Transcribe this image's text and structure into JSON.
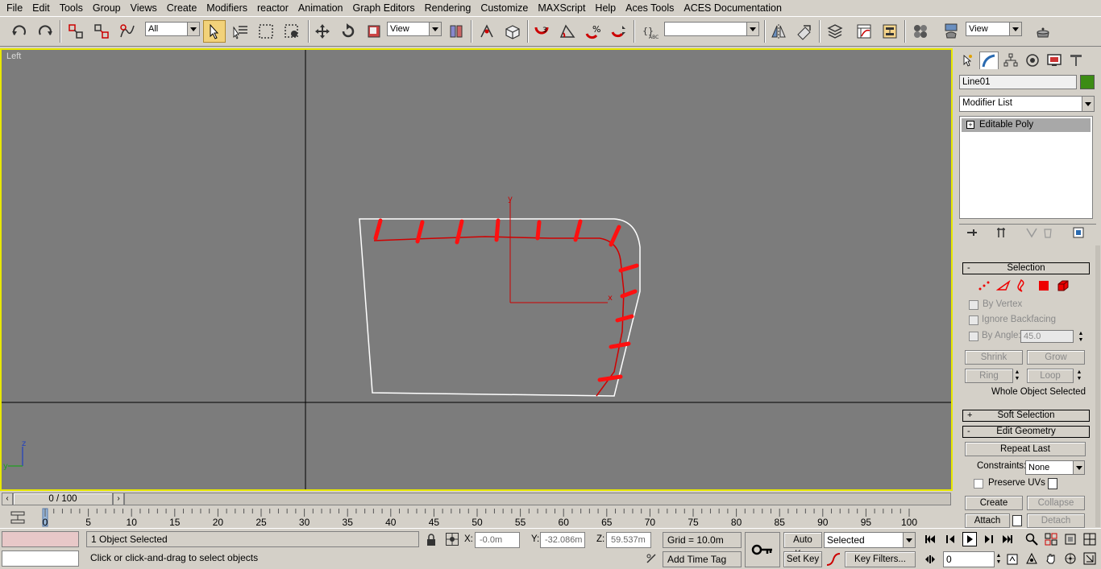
{
  "menu": [
    "File",
    "Edit",
    "Tools",
    "Group",
    "Views",
    "Create",
    "Modifiers",
    "reactor",
    "Animation",
    "Graph Editors",
    "Rendering",
    "Customize",
    "MAXScript",
    "Help",
    "Aces Tools",
    "ACES Documentation"
  ],
  "toolbar": {
    "selection_filter": "All",
    "reference_coord": "View",
    "named_selection": "",
    "view_combo": "View",
    "icons": [
      "undo-icon",
      "redo-icon",
      "select-and-link-icon",
      "unlink-selection-icon",
      "bind-to-space-warp-icon",
      "select-object-icon",
      "select-by-name-icon",
      "rectangular-selection-region-icon",
      "window-crossing-icon",
      "select-and-move-icon",
      "select-and-rotate-icon",
      "select-and-scale-icon",
      "use-pivot-center-icon",
      "select-and-manipulate-icon",
      "keyboard-shortcut-override-icon",
      "snaps-toggle-icon",
      "angle-snap-icon",
      "percent-snap-icon",
      "spinner-snap-icon",
      "edit-named-selection-icon",
      "mirror-icon",
      "align-icon",
      "layer-manager-icon",
      "curve-editor-icon",
      "schematic-view-icon",
      "material-editor-icon",
      "render-setup-icon",
      "quick-render-icon"
    ]
  },
  "viewport": {
    "label": "Left",
    "axis_y": "y",
    "axis_x": "x",
    "gizmo_z": "z",
    "gizmo_y": "y"
  },
  "command_panel": {
    "tabs": [
      "create-tab-icon",
      "modify-tab-icon",
      "hierarchy-tab-icon",
      "motion-tab-icon",
      "display-tab-icon",
      "utilities-tab-icon"
    ],
    "object_name": "Line01",
    "object_color": "#3c8c14",
    "modifier_list": "Modifier List",
    "stack_items": [
      "Editable Poly"
    ],
    "stack_expander": "+",
    "selection": {
      "title": "Selection",
      "collapse_sign": "-",
      "subobject_levels": [
        "vertex-icon",
        "edge-icon",
        "border-icon",
        "polygon-icon",
        "element-icon"
      ],
      "by_vertex": "By Vertex",
      "ignore_backfacing": "Ignore Backfacing",
      "by_angle": "By Angle:",
      "by_angle_value": "45.0",
      "shrink": "Shrink",
      "grow": "Grow",
      "ring": "Ring",
      "loop": "Loop",
      "status": "Whole Object Selected"
    },
    "soft_selection": {
      "title": "Soft Selection",
      "expand_sign": "+"
    },
    "edit_geometry": {
      "title": "Edit Geometry",
      "collapse_sign": "-",
      "repeat_last": "Repeat Last",
      "constraints_label": "Constraints:",
      "constraints_value": "None",
      "preserve_uvs": "Preserve UVs",
      "create": "Create",
      "collapse": "Collapse",
      "attach": "Attach",
      "detach": "Detach"
    }
  },
  "time": {
    "slider_label": "0 / 100",
    "ticks": [
      "0",
      "5",
      "10",
      "15",
      "20",
      "25",
      "30",
      "35",
      "40",
      "45",
      "50",
      "55",
      "60",
      "65",
      "70",
      "75",
      "80",
      "85",
      "90",
      "95",
      "100"
    ]
  },
  "status": {
    "selection_count": "1 Object Selected",
    "prompt": "Click or click-and-drag to select objects",
    "x_label": "X:",
    "x_value": "-0.0m",
    "y_label": "Y:",
    "y_value": "-32.086m",
    "z_label": "Z:",
    "z_value": "59.537m",
    "grid": "Grid = 10.0m",
    "add_time_tag": "Add Time Tag",
    "auto_key": "Auto Key",
    "set_key": "Set Key",
    "selected_combo": "Selected",
    "key_filters": "Key Filters...",
    "current_frame": "0"
  }
}
